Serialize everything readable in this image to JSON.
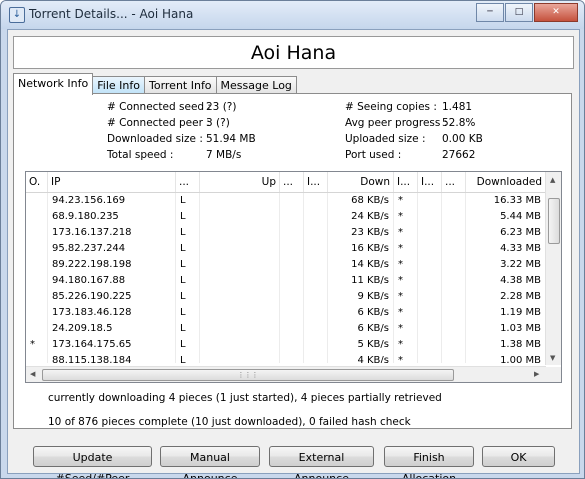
{
  "window": {
    "title": "Torrent Details... - Aoi Hana"
  },
  "header": {
    "title": "Aoi Hana"
  },
  "tabs": [
    {
      "label": "Network Info"
    },
    {
      "label": "File Info"
    },
    {
      "label": "Torrent Info"
    },
    {
      "label": "Message Log"
    }
  ],
  "info": {
    "connected_seed_label": "# Connected seed :",
    "connected_seed": "23 (?)",
    "connected_peer_label": "# Connected peer :",
    "connected_peer": "3 (?)",
    "downloaded_size_label": "Downloaded size :",
    "downloaded_size": "51.94 MB",
    "total_speed_label": "Total speed :",
    "total_speed": "7 MB/s",
    "seeing_copies_label": "# Seeing copies :",
    "seeing_copies": "1.481",
    "avg_peer_progress_label": "Avg peer progress :",
    "avg_peer_progress": "52.8%",
    "uploaded_size_label": "Uploaded size :",
    "uploaded_size": "0.00 KB",
    "port_used_label": "Port used :",
    "port_used": "27662"
  },
  "peers": {
    "columns": [
      "O.",
      "IP",
      "...",
      "Up",
      "...",
      "I...",
      "Down",
      "I...",
      "I...",
      "...",
      "Downloaded"
    ],
    "rows": [
      {
        "o": "",
        "ip": "94.23.156.169",
        "flag": "L",
        "up": "",
        "down": "68 KB/s",
        "i": "*",
        "downloaded": "16.33 MB"
      },
      {
        "o": "",
        "ip": "68.9.180.235",
        "flag": "L",
        "up": "",
        "down": "24 KB/s",
        "i": "*",
        "downloaded": "5.44 MB"
      },
      {
        "o": "",
        "ip": "173.16.137.218",
        "flag": "L",
        "up": "",
        "down": "23 KB/s",
        "i": "*",
        "downloaded": "6.23 MB"
      },
      {
        "o": "",
        "ip": "95.82.237.244",
        "flag": "L",
        "up": "",
        "down": "16 KB/s",
        "i": "*",
        "downloaded": "4.33 MB"
      },
      {
        "o": "",
        "ip": "89.222.198.198",
        "flag": "L",
        "up": "",
        "down": "14 KB/s",
        "i": "*",
        "downloaded": "3.22 MB"
      },
      {
        "o": "",
        "ip": "94.180.167.88",
        "flag": "L",
        "up": "",
        "down": "11 KB/s",
        "i": "*",
        "downloaded": "4.38 MB"
      },
      {
        "o": "",
        "ip": "85.226.190.225",
        "flag": "L",
        "up": "",
        "down": "9 KB/s",
        "i": "*",
        "downloaded": "2.28 MB"
      },
      {
        "o": "",
        "ip": "173.183.46.128",
        "flag": "L",
        "up": "",
        "down": "6 KB/s",
        "i": "*",
        "downloaded": "1.19 MB"
      },
      {
        "o": "",
        "ip": "24.209.18.5",
        "flag": "L",
        "up": "",
        "down": "6 KB/s",
        "i": "*",
        "downloaded": "1.03 MB"
      },
      {
        "o": "*",
        "ip": "173.164.175.65",
        "flag": "L",
        "up": "",
        "down": "5 KB/s",
        "i": "*",
        "downloaded": "1.38 MB"
      },
      {
        "o": "",
        "ip": "88.115.138.184",
        "flag": "L",
        "up": "",
        "down": "4 KB/s",
        "i": "*",
        "downloaded": "1.00 MB"
      }
    ]
  },
  "status": {
    "line1": "currently downloading 4 pieces (1 just started), 4 pieces partially retrieved",
    "line2": "10 of 876 pieces complete (10 just downloaded), 0 failed hash check"
  },
  "buttons": {
    "update": "Update #Seed/#Peer",
    "manual_announce": "Manual Announce",
    "external_announce": "External Announce",
    "finish_allocation": "Finish Allocation",
    "ok": "OK"
  },
  "icons": {
    "app": "download-arrow-icon",
    "minimize": "minimize-icon",
    "maximize": "maximize-icon",
    "close": "close-icon",
    "scroll_up": "scroll-up-arrow-icon",
    "scroll_down": "scroll-down-arrow-icon",
    "scroll_left": "scroll-left-arrow-icon",
    "scroll_right": "scroll-right-arrow-icon"
  }
}
